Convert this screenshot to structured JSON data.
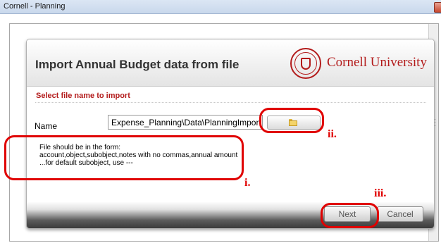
{
  "window": {
    "title": "Cornell - Planning"
  },
  "dialog": {
    "title": "Import Annual Budget data from file",
    "brand": "Cornell University",
    "section_label": "Select file name to import",
    "name_label": "Name",
    "path_value": "Expense_Planning\\Data\\PlanningImport.txt",
    "info_lines": [
      "File should be in the form:",
      "account,object,subobject,notes with no commas,annual amount",
      "...for default subobject, use ---"
    ],
    "next_label": "Next",
    "cancel_label": "Cancel"
  },
  "annotations": {
    "i": "i.",
    "ii": "ii.",
    "iii": "iii."
  },
  "colors": {
    "accent_red": "#b31b1b",
    "annotation_red": "#e00000"
  },
  "icons": {
    "browse": "folder-icon",
    "close": "close-icon"
  }
}
